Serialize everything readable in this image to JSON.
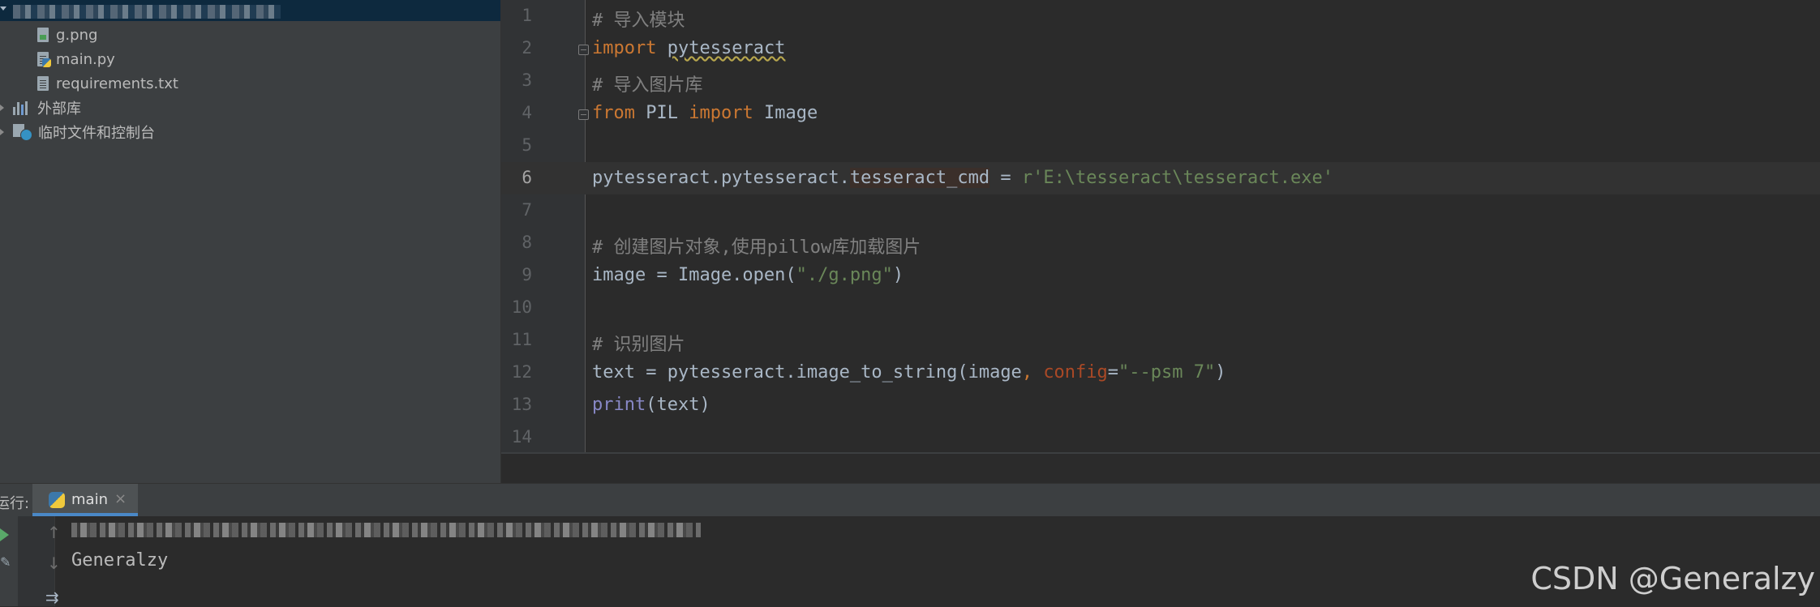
{
  "project_tree": {
    "files": [
      {
        "name": "g.png",
        "icon": "image-file-icon"
      },
      {
        "name": "main.py",
        "icon": "python-file-icon"
      },
      {
        "name": "requirements.txt",
        "icon": "text-file-icon"
      }
    ],
    "external_libraries": "外部库",
    "scratches": "临时文件和控制台"
  },
  "editor": {
    "line_numbers": [
      "1",
      "2",
      "3",
      "4",
      "5",
      "6",
      "7",
      "8",
      "9",
      "10",
      "11",
      "12",
      "13",
      "14"
    ],
    "current_line": "6",
    "lines": {
      "l1": {
        "comment": "# 导入模块"
      },
      "l2": {
        "kw": "import",
        "mod": "pytesseract"
      },
      "l3": {
        "comment": "# 导入图片库"
      },
      "l4": {
        "kw_from": "from",
        "mod": "PIL",
        "kw_import": "import",
        "name": "Image"
      },
      "l6": {
        "prefix": "pytesseract.pytesseract.",
        "attr": "tesseract_cmd",
        "op": " = ",
        "str": "r'E:\\tesseract\\tesseract.exe'"
      },
      "l8": {
        "comment": "# 创建图片对象,使用pillow库加载图片"
      },
      "l9": {
        "prefix": "image = Image.open(",
        "str": "\"./g.png\"",
        "suffix": ")"
      },
      "l11": {
        "comment": "# 识别图片"
      },
      "l12": {
        "prefix": "text = pytesseract.image_to_string(image",
        "comma": ", ",
        "param": "config",
        "eq": "=",
        "str": "\"--psm 7\"",
        "suffix": ")"
      },
      "l13": {
        "builtin": "print",
        "suffix": "(text)"
      }
    }
  },
  "run_panel": {
    "label": "运行:",
    "tab": "main",
    "close": "×",
    "output": "Generalzy"
  },
  "watermark": "CSDN @Generalzy",
  "colors": {
    "keyword": "#cc7832",
    "string": "#6a8759",
    "comment": "#808080",
    "builtin": "#8888c6",
    "param": "#aa4926",
    "text": "#a9b7c6",
    "selection_root": "#0d293e"
  }
}
